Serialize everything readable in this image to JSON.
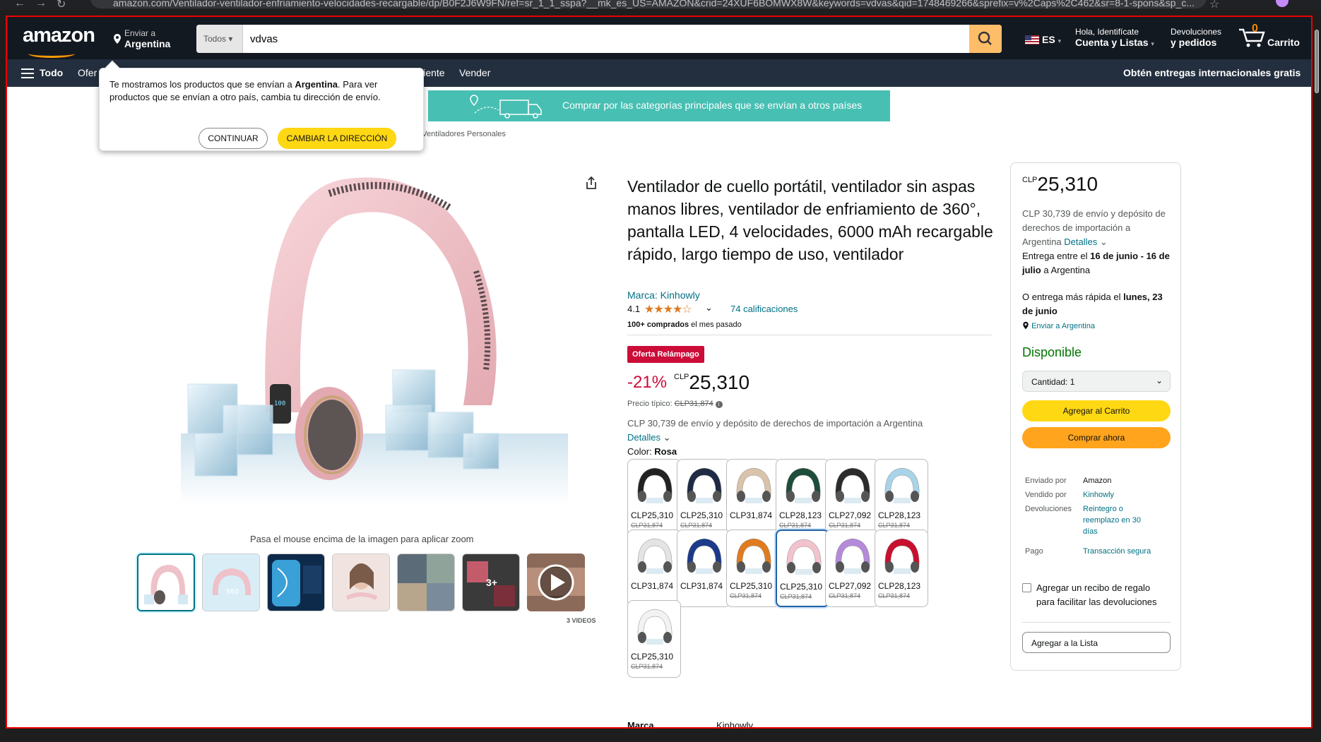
{
  "browser": {
    "url": "amazon.com/Ventilador-ventilador-enfriamiento-velocidades-recargable/dp/B0F2J6W9FN/ref=sr_1_1_sspa?__mk_es_US=AMAZON&crid=24XUF6BOMWX8W&keywords=vdvas&qid=1748469266&sprefix=v%2Caps%2C462&sr=8-1-spons&sp_c..."
  },
  "nav": {
    "logo": "amazon",
    "deliver_label": "Enviar a",
    "deliver_location": "Argentina",
    "search_category": "Todos",
    "search_value": "vdvas",
    "lang": "ES",
    "account_line1": "Hola, Identifícate",
    "account_line2": "Cuenta y Listas",
    "returns_line1": "Devoluciones",
    "returns_line2": "y pedidos",
    "cart_count": "0",
    "cart_label": "Carrito"
  },
  "subnav": {
    "all": "Todo",
    "items": [
      "Ofer",
      "Cliente",
      "Vender"
    ],
    "promo": "Obtén entregas internacionales gratis"
  },
  "popover": {
    "message_pre": "Te mostramos los productos que se envían a ",
    "message_bold": "Argentina",
    "message_post": ". Para ver productos que se envían a otro país, cambia tu dirección de envío.",
    "continue_label": "CONTINUAR",
    "change_label": "CAMBIAR LA DIRECCIÓN"
  },
  "banner": {
    "text": "Comprar por las categorías principales que se envían a otros países"
  },
  "breadcrumb": {
    "text": "s  ›  Ventiladores Personales"
  },
  "gallery": {
    "zoom_hint": "Pasa el mouse encima de la imagen para aplicar zoom",
    "more_badge": "3+",
    "videos_label": "3 VIDEOS"
  },
  "product": {
    "title": "Ventilador de cuello portátil, ventilador sin aspas manos libres, ventilador de enfriamiento de 360°, pantalla LED, 4 velocidades, 6000 mAh recargable rápido, largo tiempo de uso, ventilador",
    "brand": "Marca: Kinhowly",
    "rating": "4.1",
    "stars": 4.1,
    "ratings_count": "74 calificaciones",
    "bought_bold": "100+ comprados",
    "bought_rest": " el mes pasado",
    "deal_badge": "Oferta Relámpago",
    "discount": "-21%",
    "currency": "CLP",
    "price": "25,310",
    "typical_label": "Precio típico: ",
    "typical_price": "CLP31,874",
    "ship_note": "CLP 30,739 de envío y depósito de derechos de importación a Argentina",
    "details_label": "Detalles",
    "color_label": "Color: ",
    "color_value": "Rosa",
    "marca_label": "Marca",
    "marca_value": "Kinhowly"
  },
  "swatches": [
    {
      "price": "CLP25,310",
      "old": "CLP31,874",
      "color": "#222222"
    },
    {
      "price": "CLP25,310",
      "old": "CLP31,874",
      "color": "#1f2a44"
    },
    {
      "price": "CLP31,874",
      "old": "",
      "color": "#d9c3aa"
    },
    {
      "price": "CLP28,123",
      "old": "CLP31,874",
      "color": "#1e4d3a"
    },
    {
      "price": "CLP27,092",
      "old": "CLP31,874",
      "color": "#2b2b2b"
    },
    {
      "price": "CLP28,123",
      "old": "CLP31,874",
      "color": "#a9d3e8"
    },
    {
      "price": "CLP31,874",
      "old": "",
      "color": "#e4e4e4"
    },
    {
      "price": "CLP31,874",
      "old": "",
      "color": "#1d3a8a"
    },
    {
      "price": "CLP25,310",
      "old": "CLP31,874",
      "color": "#e07b1e"
    },
    {
      "price": "CLP25,310",
      "old": "CLP31,874",
      "color": "#f2c3cc"
    },
    {
      "price": "CLP27,092",
      "old": "CLP31,874",
      "color": "#b58ad9"
    },
    {
      "price": "CLP28,123",
      "old": "CLP31,874",
      "color": "#c8102e"
    },
    {
      "price": "CLP25,310",
      "old": "CLP31,874",
      "color": "#f2f2f2"
    }
  ],
  "buybox": {
    "currency": "CLP",
    "price": "25,310",
    "ship_text": "CLP 30,739 de envío y depósito de derechos de importación a Argentina ",
    "ship_link": "Detalles",
    "delivery_pre": "Entrega entre el ",
    "delivery_bold1": "16 de junio - 16 de julio",
    "delivery_post": " a Argentina",
    "fast_pre": "O entrega más rápida el ",
    "fast_bold": "lunes, 23 de junio",
    "location": "Enviar a Argentina",
    "stock": "Disponible",
    "qty": "Cantidad:  1",
    "add_to_cart": "Agregar al Carrito",
    "buy_now": "Comprar ahora",
    "shipped_by_k": "Enviado por",
    "shipped_by_v": "Amazon",
    "sold_by_k": "Vendido por",
    "sold_by_v": "Kinhowly",
    "returns_k": "Devoluciones",
    "returns_v": "Reintegro o reemplazo en 30 días",
    "payment_k": "Pago",
    "payment_v": "Transacción segura",
    "gift": "Agregar un recibo de regalo para facilitar las devoluciones",
    "add_to_list": "Agregar a la Lista"
  },
  "colors": {
    "nav": "#131921",
    "subnav": "#232f3e",
    "accent": "#ff9900",
    "link": "#007185",
    "deal": "#cc0c39",
    "cart_btn": "#ffd814",
    "buy_btn": "#ffa41c"
  }
}
